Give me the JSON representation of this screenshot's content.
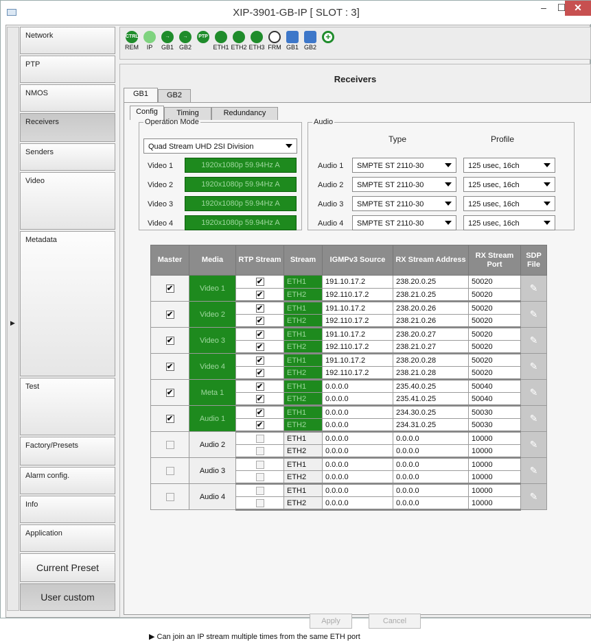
{
  "window": {
    "title": "XIP-3901-GB-IP [ SLOT : 3]",
    "min": "–",
    "max": "☐",
    "close": "✕"
  },
  "sidebar": {
    "items": [
      {
        "label": "Network"
      },
      {
        "label": "PTP"
      },
      {
        "label": "NMOS"
      },
      {
        "label": "Receivers"
      },
      {
        "label": "Senders"
      },
      {
        "label": "Video"
      },
      {
        "label": "Metadata"
      },
      {
        "label": "Test"
      },
      {
        "label": "Factory/Presets"
      },
      {
        "label": "Alarm config."
      },
      {
        "label": "Info"
      },
      {
        "label": "Application"
      },
      {
        "label": "Current Preset"
      },
      {
        "label": "User custom"
      }
    ]
  },
  "toolbar": {
    "icons": [
      {
        "icon": "CTRL",
        "label": "REM"
      },
      {
        "icon": "",
        "label": "IP"
      },
      {
        "icon": "→",
        "label": "GB1"
      },
      {
        "icon": "→",
        "label": "GB2"
      },
      {
        "icon": "PTP",
        "label": ""
      },
      {
        "icon": "",
        "label": "ETH1"
      },
      {
        "icon": "",
        "label": "ETH2"
      },
      {
        "icon": "",
        "label": "ETH3"
      },
      {
        "icon": "",
        "label": "FRM"
      },
      {
        "icon": "",
        "label": "GB1"
      },
      {
        "icon": "",
        "label": "GB2"
      },
      {
        "icon": "+",
        "label": ""
      }
    ]
  },
  "main": {
    "title": "Receivers",
    "tabs": [
      "GB1",
      "GB2"
    ],
    "subtabs": [
      "Config",
      "Timing",
      "Redundancy"
    ],
    "operation_mode": {
      "legend": "Operation Mode",
      "value": "Quad Stream UHD 2SI Division",
      "videos": [
        {
          "label": "Video 1",
          "value": "1920x1080p 59.94Hz A"
        },
        {
          "label": "Video 2",
          "value": "1920x1080p 59.94Hz A"
        },
        {
          "label": "Video 3",
          "value": "1920x1080p 59.94Hz A"
        },
        {
          "label": "Video 4",
          "value": "1920x1080p 59.94Hz A"
        }
      ]
    },
    "audio": {
      "legend": "Audio",
      "type_header": "Type",
      "profile_header": "Profile",
      "rows": [
        {
          "label": "Audio 1",
          "type": "SMPTE ST 2110-30",
          "profile": "125 usec, 16ch"
        },
        {
          "label": "Audio 2",
          "type": "SMPTE ST 2110-30",
          "profile": "125 usec, 16ch"
        },
        {
          "label": "Audio 3",
          "type": "SMPTE ST 2110-30",
          "profile": "125 usec, 16ch"
        },
        {
          "label": "Audio 4",
          "type": "SMPTE ST 2110-30",
          "profile": "125 usec, 16ch"
        }
      ]
    },
    "table": {
      "headers": [
        "Master",
        "Media",
        "RTP Stream",
        "Stream",
        "IGMPv3 Source",
        "RX Stream Address",
        "RX Stream Port",
        "SDP File"
      ],
      "groups": [
        {
          "master": true,
          "media": "Video 1",
          "active": true,
          "rows": [
            {
              "rtp": true,
              "stream": "ETH1",
              "source": "191.10.17.2",
              "address": "238.20.0.25",
              "port": "50020"
            },
            {
              "rtp": true,
              "stream": "ETH2",
              "source": "192.110.17.2",
              "address": "238.21.0.25",
              "port": "50020"
            }
          ]
        },
        {
          "master": true,
          "media": "Video 2",
          "active": true,
          "rows": [
            {
              "rtp": true,
              "stream": "ETH1",
              "source": "191.10.17.2",
              "address": "238.20.0.26",
              "port": "50020"
            },
            {
              "rtp": true,
              "stream": "ETH2",
              "source": "192.110.17.2",
              "address": "238.21.0.26",
              "port": "50020"
            }
          ]
        },
        {
          "master": true,
          "media": "Video 3",
          "active": true,
          "rows": [
            {
              "rtp": true,
              "stream": "ETH1",
              "source": "191.10.17.2",
              "address": "238.20.0.27",
              "port": "50020"
            },
            {
              "rtp": true,
              "stream": "ETH2",
              "source": "192.110.17.2",
              "address": "238.21.0.27",
              "port": "50020"
            }
          ]
        },
        {
          "master": true,
          "media": "Video 4",
          "active": true,
          "rows": [
            {
              "rtp": true,
              "stream": "ETH1",
              "source": "191.10.17.2",
              "address": "238.20.0.28",
              "port": "50020"
            },
            {
              "rtp": true,
              "stream": "ETH2",
              "source": "192.110.17.2",
              "address": "238.21.0.28",
              "port": "50020"
            }
          ]
        },
        {
          "master": true,
          "media": "Meta 1",
          "active": true,
          "rows": [
            {
              "rtp": true,
              "stream": "ETH1",
              "source": "0.0.0.0",
              "address": "235.40.0.25",
              "port": "50040"
            },
            {
              "rtp": true,
              "stream": "ETH2",
              "source": "0.0.0.0",
              "address": "235.41.0.25",
              "port": "50040"
            }
          ]
        },
        {
          "master": true,
          "media": "Audio 1",
          "active": true,
          "rows": [
            {
              "rtp": true,
              "stream": "ETH1",
              "source": "0.0.0.0",
              "address": "234.30.0.25",
              "port": "50030"
            },
            {
              "rtp": true,
              "stream": "ETH2",
              "source": "0.0.0.0",
              "address": "234.31.0.25",
              "port": "50030"
            }
          ]
        },
        {
          "master": false,
          "media": "Audio 2",
          "active": false,
          "rows": [
            {
              "rtp": false,
              "stream": "ETH1",
              "source": "0.0.0.0",
              "address": "0.0.0.0",
              "port": "10000"
            },
            {
              "rtp": false,
              "stream": "ETH2",
              "source": "0.0.0.0",
              "address": "0.0.0.0",
              "port": "10000"
            }
          ]
        },
        {
          "master": false,
          "media": "Audio 3",
          "active": false,
          "rows": [
            {
              "rtp": false,
              "stream": "ETH1",
              "source": "0.0.0.0",
              "address": "0.0.0.0",
              "port": "10000"
            },
            {
              "rtp": false,
              "stream": "ETH2",
              "source": "0.0.0.0",
              "address": "0.0.0.0",
              "port": "10000"
            }
          ]
        },
        {
          "master": false,
          "media": "Audio 4",
          "active": false,
          "rows": [
            {
              "rtp": false,
              "stream": "ETH1",
              "source": "0.0.0.0",
              "address": "0.0.0.0",
              "port": "10000"
            },
            {
              "rtp": false,
              "stream": "ETH2",
              "source": "0.0.0.0",
              "address": "0.0.0.0",
              "port": "10000"
            }
          ]
        }
      ]
    },
    "apply_label": "Apply",
    "cancel_label": "Cancel",
    "note": "▶ Can join an IP stream multiple times from the same ETH port"
  }
}
